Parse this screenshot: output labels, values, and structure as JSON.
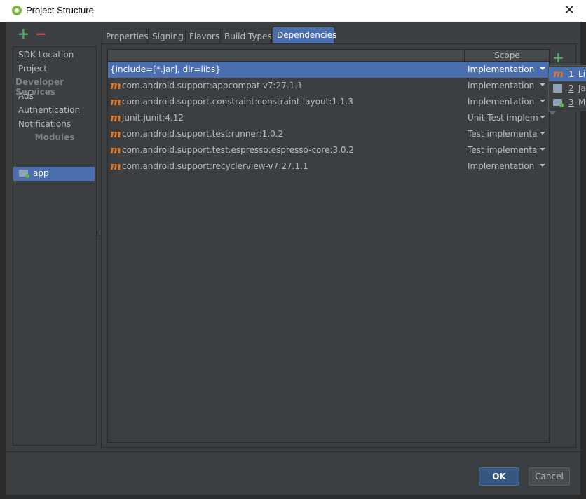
{
  "window": {
    "title": "Project Structure",
    "close_glyph": "✕"
  },
  "toolbar": {
    "add": "+",
    "remove": "−"
  },
  "sidebar": {
    "items": [
      {
        "label": "SDK Location"
      },
      {
        "label": "Project"
      }
    ],
    "dev_header": "Developer Services",
    "dev_items": [
      {
        "label": "Ads"
      },
      {
        "label": "Authentication"
      },
      {
        "label": "Notifications"
      }
    ],
    "modules_header": "Modules",
    "modules": [
      {
        "label": "app",
        "selected": true
      }
    ]
  },
  "tabs": [
    {
      "label": "Properties"
    },
    {
      "label": "Signing"
    },
    {
      "label": "Flavors"
    },
    {
      "label": "Build Types"
    },
    {
      "label": "Dependencies",
      "active": true
    }
  ],
  "table": {
    "header_scope": "Scope",
    "rows": [
      {
        "name": "{include=[*.jar], dir=libs}",
        "scope": "Implementation",
        "icon": "",
        "selected": true
      },
      {
        "name": "com.android.support:appcompat-v7:27.1.1",
        "scope": "Implementation",
        "icon": "m"
      },
      {
        "name": "com.android.support.constraint:constraint-layout:1.1.3",
        "scope": "Implementation",
        "icon": "m"
      },
      {
        "name": "junit:junit:4.12",
        "scope": "Unit Test impleme...",
        "icon": "m"
      },
      {
        "name": "com.android.support.test:runner:1.0.2",
        "scope": "Test implementation",
        "icon": "m"
      },
      {
        "name": "com.android.support.test.espresso:espresso-core:3.0.2",
        "scope": "Test implementation",
        "icon": "m"
      },
      {
        "name": "com.android.support:recyclerview-v7:27.1.1",
        "scope": "Implementation",
        "icon": "m"
      }
    ],
    "add_glyph": "+"
  },
  "add_menu": {
    "items": [
      {
        "num": "1",
        "text": "Li",
        "icon": "maven-icon",
        "selected": true
      },
      {
        "num": "2",
        "text": "Ja",
        "icon": "jar-icon"
      },
      {
        "num": "3",
        "text": "M",
        "icon": "module-icon"
      }
    ]
  },
  "buttons": {
    "ok": "OK",
    "cancel": "Cancel"
  },
  "colors": {
    "selection": "#4b6eaf",
    "maven": "#e8761c",
    "add": "#59a869",
    "remove": "#c75450"
  }
}
